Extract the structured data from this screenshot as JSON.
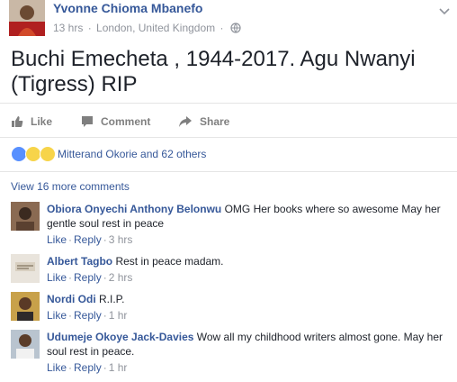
{
  "post": {
    "author": "Yvonne Chioma Mbanefo",
    "time": "13 hrs",
    "location": "London, United Kingdom",
    "text": "Buchi Emecheta , 1944-2017. Agu Nwanyi (Tigress) RIP",
    "privacy_icon": "globe-icon"
  },
  "actions": {
    "like": "Like",
    "comment": "Comment",
    "share": "Share"
  },
  "reactions": {
    "summary": "Mitterand Okorie and 62 others",
    "types": [
      "like",
      "sad",
      "wow"
    ]
  },
  "view_more": "View 16 more comments",
  "comments": [
    {
      "name": "Obiora Onyechi Anthony Belonwu",
      "text": "OMG Her books where so awesome May her gentle soul rest in peace",
      "like": "Like",
      "reply": "Reply",
      "time": "3 hrs"
    },
    {
      "name": "Albert Tagbo",
      "text": "Rest in peace madam.",
      "like": "Like",
      "reply": "Reply",
      "time": "2 hrs"
    },
    {
      "name": "Nordi Odi",
      "text": "R.I.P.",
      "like": "Like",
      "reply": "Reply",
      "time": "1 hr"
    },
    {
      "name": "Udumeje Okoye Jack-Davies",
      "text": "Wow all my childhood writers almost gone. May her soul rest in peace.",
      "like": "Like",
      "reply": "Reply",
      "time": "1 hr"
    }
  ]
}
